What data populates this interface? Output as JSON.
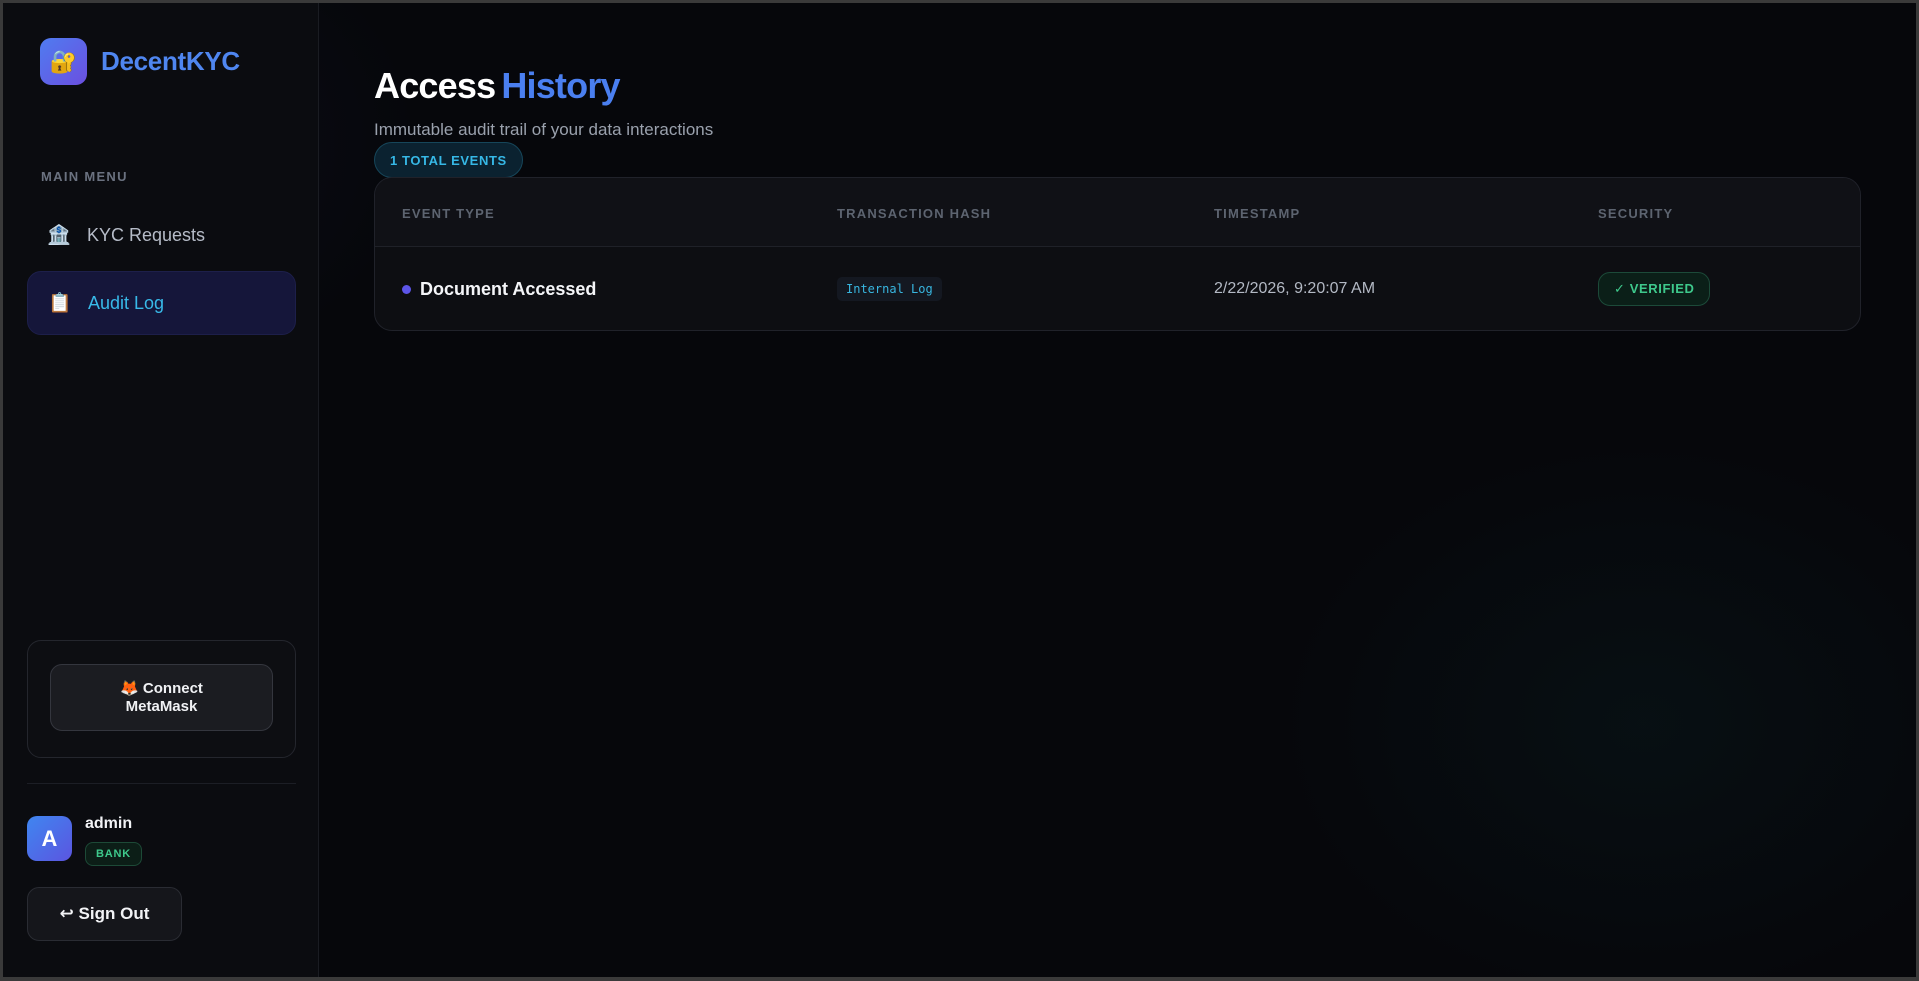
{
  "brand": {
    "name": "DecentKYC",
    "logo_icon": "🔐"
  },
  "sidebar": {
    "menu_label": "MAIN MENU",
    "items": [
      {
        "label": "KYC Requests",
        "icon": "🏦",
        "active": false
      },
      {
        "label": "Audit Log",
        "icon": "📋",
        "active": true
      }
    ],
    "wallet_button": {
      "line1": "🦊 Connect",
      "line2": "MetaMask"
    },
    "user": {
      "initial": "A",
      "name": "admin",
      "role": "BANK"
    },
    "signout_label": "↩ Sign Out"
  },
  "main": {
    "title_part1": "Access",
    "title_part2": "History",
    "subtitle": "Immutable audit trail of your data interactions",
    "events_count": "1 TOTAL EVENTS",
    "table": {
      "headers": [
        "EVENT TYPE",
        "TRANSACTION HASH",
        "TIMESTAMP",
        "SECURITY"
      ],
      "rows": [
        {
          "event_type": "Document Accessed",
          "tx_hash": "Internal Log",
          "timestamp": "2/22/2026, 9:20:07 AM",
          "security": "✓ VERIFIED"
        }
      ]
    }
  },
  "colors": {
    "accent_blue": "#4a7ff0",
    "accent_cyan": "#36b8e6",
    "success_green": "#3ec98c",
    "background": "#06070b"
  }
}
